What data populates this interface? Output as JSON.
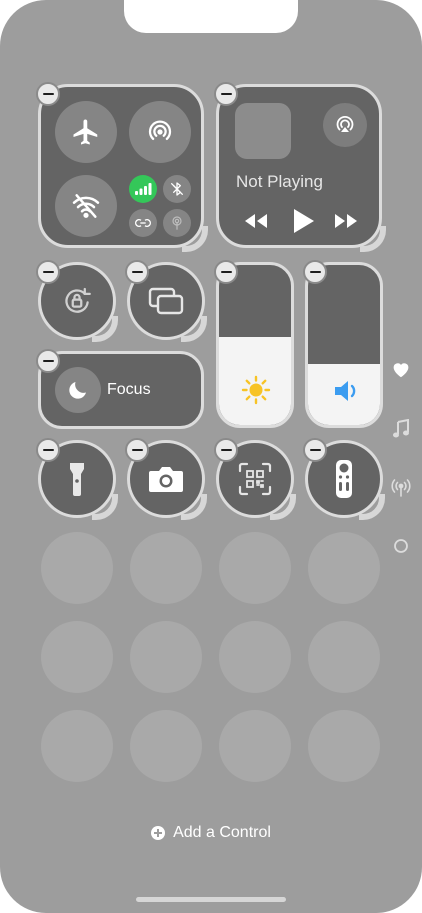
{
  "now_playing": {
    "status_label": "Not Playing"
  },
  "focus": {
    "label": "Focus"
  },
  "sliders": {
    "brightness_level": 0.55,
    "volume_level": 0.38
  },
  "footer": {
    "add_control_label": "Add a Control"
  },
  "colors": {
    "cellular_active": "#34c759",
    "sun": "#f7c325",
    "speaker": "#3b9cf0"
  },
  "side_bar": {
    "icons": [
      "heart-icon",
      "music-note-icon",
      "wireless-icon",
      "circle-icon"
    ]
  },
  "icons": {
    "connectivity": [
      "airplane-icon",
      "airdrop-icon",
      "wifi-off-icon",
      "cellular-icon",
      "bluetooth-off-icon",
      "personal-hotspot-icon",
      "vpn-icon"
    ],
    "media": [
      "airplay-icon",
      "rewind-icon",
      "play-icon",
      "fast-forward-icon"
    ],
    "small_controls": [
      "orientation-lock-icon",
      "screen-mirroring-icon",
      "moon-icon",
      "flashlight-icon",
      "camera-icon",
      "qr-scanner-icon",
      "apple-tv-remote-icon"
    ]
  }
}
